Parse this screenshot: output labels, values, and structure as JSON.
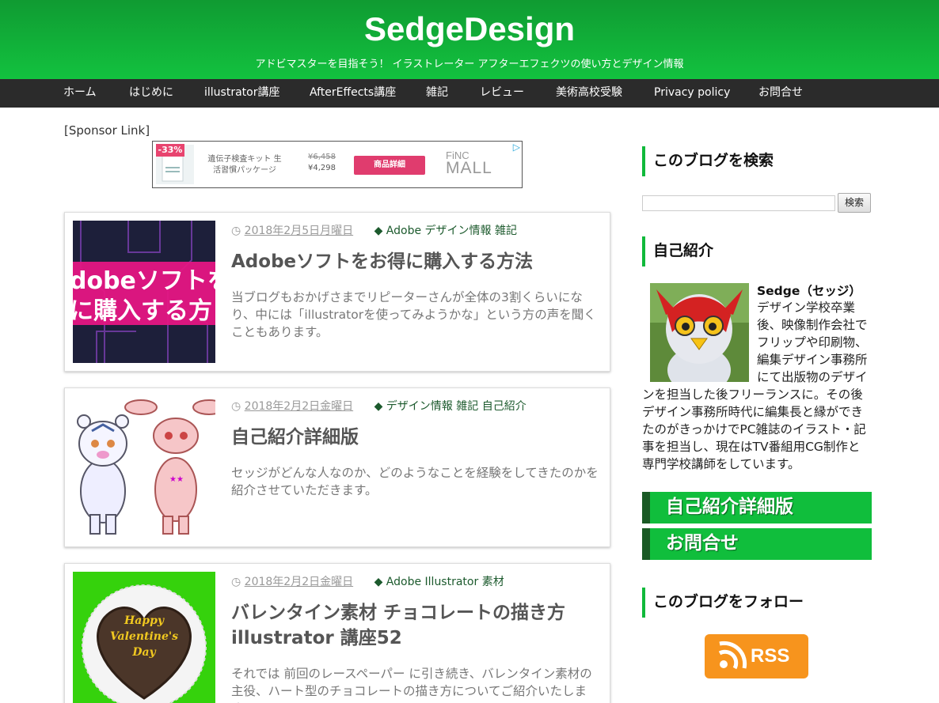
{
  "header": {
    "title": "SedgeDesign",
    "description": "アドビマスターを目指そう！ イラストレーター アフターエフェクツの使い方とデザイン情報"
  },
  "nav": [
    "ホーム",
    "はじめに",
    "illustrator講座",
    "AfterEffects講座",
    "雑記",
    "レビュー",
    "美術高校受験",
    "Privacy policy",
    "お問合せ"
  ],
  "sponsor_label": "[Sponsor Link]",
  "ad": {
    "discount": "-33%",
    "product": "遺伝子検査キット 生活習慣パッケージ",
    "old_price": "¥6,458",
    "new_price": "¥4,298",
    "button": "商品詳細",
    "logo_small": "FiNC",
    "logo_big": "MALL",
    "choice": "▷"
  },
  "posts": [
    {
      "date": "2018年2月5日月曜日",
      "categories": "Adobe デザイン情報 雑記",
      "title": "Adobeソフトをお得に購入する方法",
      "excerpt": "当ブログもおかげさまでリピーターさんが全体の3割くらいになり、中には「illustratorを使ってみようかな」という方の声を聞くこともあります。",
      "thumb_text": [
        "dobeソフトを",
        "に購入する方"
      ]
    },
    {
      "date": "2018年2月2日金曜日",
      "categories": "デザイン情報 雑記 自己紹介",
      "title": "自己紹介詳細版",
      "excerpt": "セッジがどんな人なのか、どのようなことを経験をしてきたのかを紹介させていただきます。"
    },
    {
      "date": "2018年2月2日金曜日",
      "categories": "Adobe Illustrator 素材",
      "title": "バレンタイン素材 チョコレートの描き方 illustrator 講座52",
      "excerpt": "それでは 前回のレースペーパー に引き続き、バレンタイン素材の主役、ハート型のチョコレートの描き方についてご紹介いたします。",
      "thumb_text": [
        "Happy",
        "Valentine's",
        "Day"
      ]
    }
  ],
  "sidebar": {
    "search_title": "このブログを検索",
    "search_button": "検索",
    "profile_title": "自己紹介",
    "profile_name": "Sedge（セッジ）",
    "profile_text": "デザイン学校卒業後、映像制作会社でフリップや印刷物、編集デザイン事務所にて出版物のデザインを担当した後フリーランスに。その後デザイン事務所時代に編集長と縁ができたのがきっかけでPC雑誌のイラスト・記事を担当し、現在はTV番組用CG制作と専門学校講師をしています。",
    "links": [
      "自己紹介詳細版",
      "お問合せ"
    ],
    "follow_title": "このブログをフォロー",
    "rss_label": "RSS"
  },
  "colors": {
    "header_green": "#12c23f",
    "nav_bg": "#2b2b2b",
    "accent_green": "#10be3c",
    "rss_orange": "#f7941d"
  }
}
